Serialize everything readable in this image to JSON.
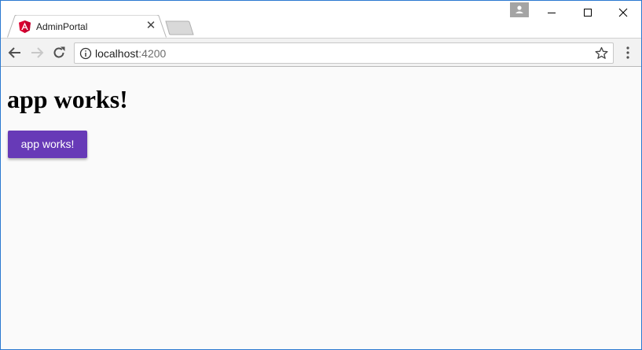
{
  "browser": {
    "tab": {
      "title": "AdminPortal",
      "favicon": "angular-logo-icon",
      "close_glyph": "✕"
    },
    "address_bar": {
      "host": "localhost",
      "port": ":4200",
      "info_icon": "info-icon",
      "bookmark_icon": "star-icon"
    },
    "nav": {
      "back_icon": "back-arrow-icon",
      "forward_icon": "forward-arrow-icon",
      "reload_icon": "reload-icon",
      "menu_icon": "kebab-menu-icon"
    },
    "window_controls": [
      "minimize-icon",
      "maximize-icon",
      "close-icon"
    ],
    "colors": {
      "window_border": "#2b79d0",
      "toolbar": "#f2f2f2"
    }
  },
  "page": {
    "heading": "app works!",
    "button_label": "app works!",
    "colors": {
      "background": "#fafafa",
      "button": "#673ab7",
      "button_text": "#ffffff"
    }
  }
}
